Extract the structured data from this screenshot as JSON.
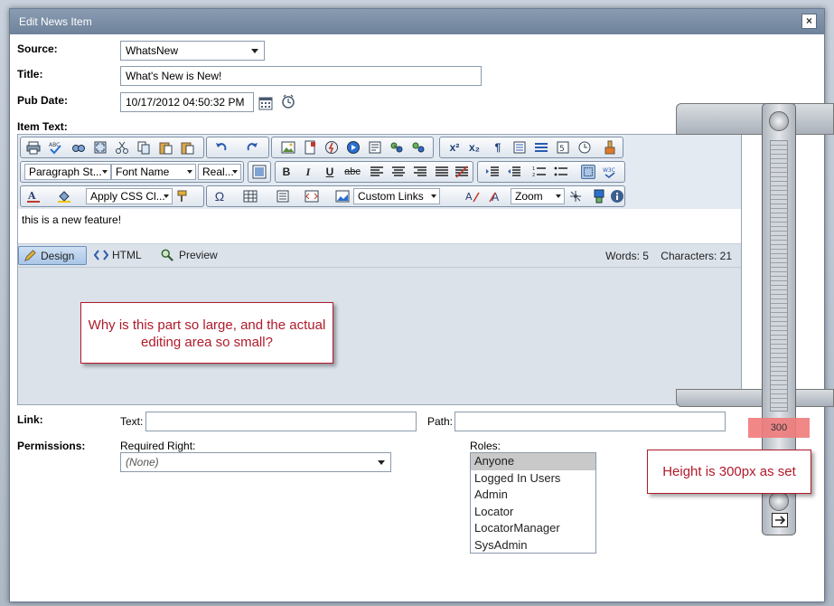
{
  "dialog": {
    "title": "Edit News Item",
    "close_label": "×"
  },
  "form": {
    "source_label": "Source:",
    "source_value": "WhatsNew",
    "title_label": "Title:",
    "title_value": "What's New is New!",
    "pub_date_label": "Pub Date:",
    "pub_date_value": "10/17/2012 04:50:32 PM",
    "item_text_label": "Item Text:",
    "link_label": "Link:",
    "text_label": "Text:",
    "path_label": "Path:",
    "permissions_label": "Permissions:",
    "required_right_label": "Required Right:",
    "required_right_value": "(None)",
    "roles_label": "Roles:",
    "roles": [
      "Anyone",
      "Logged In Users",
      "Admin",
      "Locator",
      "LocatorManager",
      "SysAdmin"
    ]
  },
  "toolbar": {
    "paragraph_style": "Paragraph St...",
    "font_name": "Font Name",
    "font_size": "Real...",
    "css_class": "Apply CSS Cl...",
    "custom_links": "Custom Links",
    "zoom": "Zoom",
    "bold": "B",
    "italic": "I",
    "underline": "U",
    "strike": "abc",
    "omega": "Ω"
  },
  "editor": {
    "content": "this is a new feature!",
    "tab_design": "Design",
    "tab_html": "HTML",
    "tab_preview": "Preview",
    "words": "Words: 5",
    "characters": "Characters: 21"
  },
  "annotations": {
    "callout_question": "Why is this part so large, and the actual editing area so small?",
    "callout_height": "Height is 300px as set",
    "ruler_readout": "300"
  }
}
